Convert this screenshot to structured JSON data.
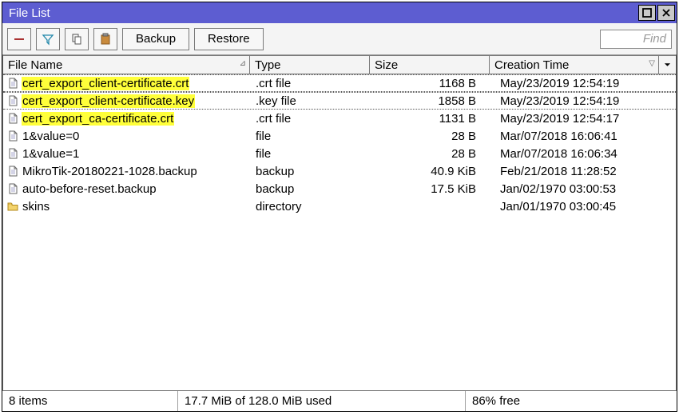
{
  "window": {
    "title": "File List"
  },
  "toolbar": {
    "backup_label": "Backup",
    "restore_label": "Restore",
    "find_placeholder": "Find"
  },
  "columns": {
    "name": "File Name",
    "type": "Type",
    "size": "Size",
    "ctime": "Creation Time"
  },
  "rows": [
    {
      "icon": "file",
      "name": "cert_export_client-certificate.crt",
      "type": ".crt file",
      "size": "1168 B",
      "ctime": "May/23/2019 12:54:19",
      "highlight": true,
      "selected": true
    },
    {
      "icon": "file",
      "name": "cert_export_client-certificate.key",
      "type": ".key file",
      "size": "1858 B",
      "ctime": "May/23/2019 12:54:19",
      "highlight": true,
      "selected": true
    },
    {
      "icon": "file",
      "name": "cert_export_ca-certificate.crt",
      "type": ".crt file",
      "size": "1131 B",
      "ctime": "May/23/2019 12:54:17",
      "highlight": true,
      "selected": false
    },
    {
      "icon": "file",
      "name": "1&value=0",
      "type": "file",
      "size": "28 B",
      "ctime": "Mar/07/2018 16:06:41",
      "highlight": false,
      "selected": false
    },
    {
      "icon": "file",
      "name": "1&value=1",
      "type": "file",
      "size": "28 B",
      "ctime": "Mar/07/2018 16:06:34",
      "highlight": false,
      "selected": false
    },
    {
      "icon": "file",
      "name": "MikroTik-20180221-1028.backup",
      "type": "backup",
      "size": "40.9 KiB",
      "ctime": "Feb/21/2018 11:28:52",
      "highlight": false,
      "selected": false
    },
    {
      "icon": "file",
      "name": "auto-before-reset.backup",
      "type": "backup",
      "size": "17.5 KiB",
      "ctime": "Jan/02/1970 03:00:53",
      "highlight": false,
      "selected": false
    },
    {
      "icon": "folder",
      "name": "skins",
      "type": "directory",
      "size": "",
      "ctime": "Jan/01/1970 03:00:45",
      "highlight": false,
      "selected": false
    }
  ],
  "status": {
    "items": "8 items",
    "usage": "17.7 MiB of 128.0 MiB used",
    "free": "86% free"
  }
}
